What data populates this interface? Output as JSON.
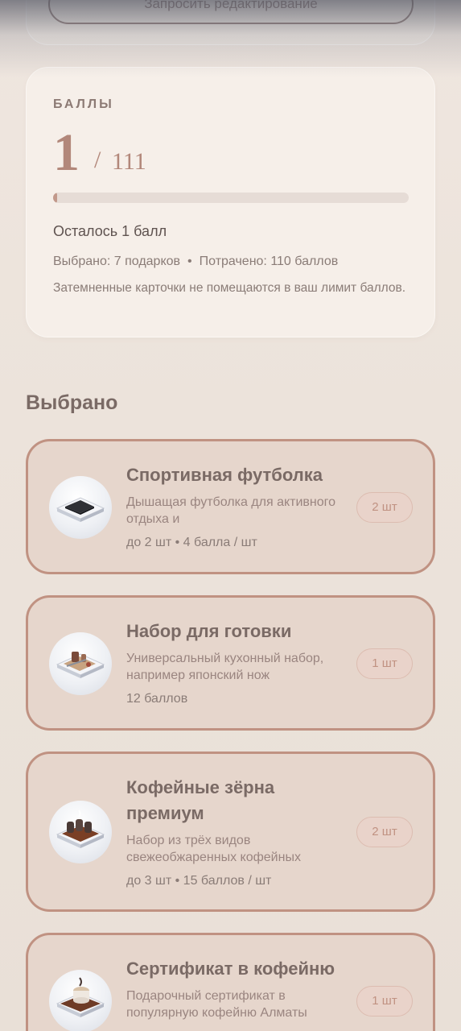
{
  "top": {
    "edit_button_label": "Запросить редактирование"
  },
  "points": {
    "label": "БАЛЛЫ",
    "current": "1",
    "separator": "/",
    "total": "111",
    "progress_fraction": 0.009,
    "remaining_text": "Осталось 1 балл",
    "selected_text": "Выбрано: 7 подарков",
    "dot": "•",
    "spent_text": "Потрачено: 110 баллов",
    "hint": "Затемненные карточки не помещаются в ваш лимит баллов."
  },
  "selected": {
    "title": "Выбрано",
    "items": [
      {
        "title": "Спортивная футболка",
        "description": "Дышащая футболка для активного отдыха и",
        "meta": "до 2 шт • 4 балла / шт",
        "qty": "2 шт",
        "icon": "tshirt-icon"
      },
      {
        "title": "Набор для готовки",
        "description": "Универсальный кухонный набор, например японский нож",
        "meta": "12 баллов",
        "qty": "1 шт",
        "icon": "cooking-set-icon"
      },
      {
        "title": "Кофейные зёрна премиум",
        "description": "Набор из трёх видов свежеобжаренных кофейных",
        "meta": "до 3 шт • 15 баллов / шт",
        "qty": "2 шт",
        "icon": "coffee-beans-icon"
      },
      {
        "title": "Сертификат в кофейню",
        "description": "Подарочный сертификат в популярную кофейню Алматы",
        "meta": "",
        "qty": "1 шт",
        "icon": "coffee-certificate-icon"
      }
    ]
  },
  "colors": {
    "accent": "#b2877a",
    "card_border": "#c09282",
    "card_bg": "#e6d6cc"
  }
}
